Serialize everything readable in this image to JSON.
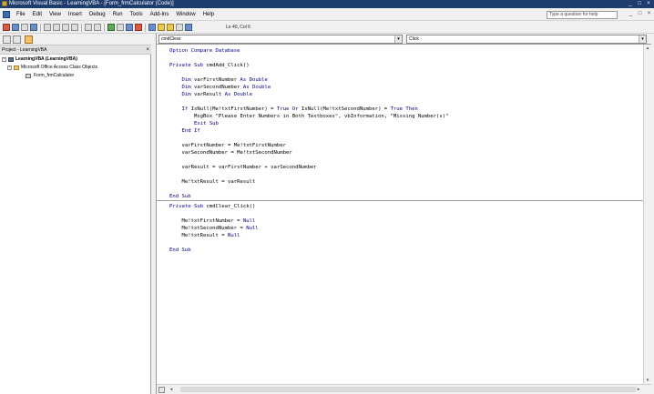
{
  "window": {
    "title": "Microsoft Visual Basic - LearningVBA - [Form_frmCalculator (Code)]",
    "controls": [
      "_",
      "□",
      "×"
    ]
  },
  "menu": {
    "items": [
      "File",
      "Edit",
      "View",
      "Insert",
      "Debug",
      "Run",
      "Tools",
      "Add-Ins",
      "Window",
      "Help"
    ],
    "help_placeholder": "Type a question for help",
    "mdi_controls": [
      "_",
      "□",
      "×"
    ]
  },
  "toolbar": {
    "position": "Ln 40, Col 6"
  },
  "project": {
    "caption": "Project - LearningVBA",
    "close": "×",
    "tree": [
      {
        "label": "LearningVBA (LearningVBA)",
        "bold": true,
        "expander": "-",
        "icon": "project-icon"
      },
      {
        "label": "Microsoft Office Access Class Objects",
        "bold": false,
        "expander": "-",
        "icon": "folder-icon"
      },
      {
        "label": "Form_frmCalculator",
        "bold": false,
        "expander": "",
        "icon": "form-icon"
      }
    ]
  },
  "code": {
    "object_dropdown": "cmdClear",
    "procedure_dropdown": "Click",
    "lines": [
      "Option Compare Database",
      "",
      "Private Sub cmdAdd_Click()",
      "",
      "    Dim varFirstNumber As Double",
      "    Dim varSecondNumber As Double",
      "    Dim varResult As Double",
      "",
      "    If IsNull(Me!txtFirstNumber) = True Or IsNull(Me!txtSecondNumber) = True Then",
      "        MsgBox \"Please Enter Numbers in Both Textboxes\", vbInformation, \"Missing Number(s)\"",
      "        Exit Sub",
      "    End If",
      "",
      "    varFirstNumber = Me!txtFirstNumber",
      "    varSecondNumber = Me!txtSecondNumber",
      "",
      "    varResult = varFirstNumber + varSecondNumber",
      "",
      "    Me!txtResult = varResult",
      "",
      "End Sub",
      "Private Sub cmdClear_Click()",
      "",
      "    Me!txtFirstNumber = Null",
      "    Me!txtSecondNumber = Null",
      "    Me!txtResult = Null",
      "",
      "End Sub"
    ]
  }
}
